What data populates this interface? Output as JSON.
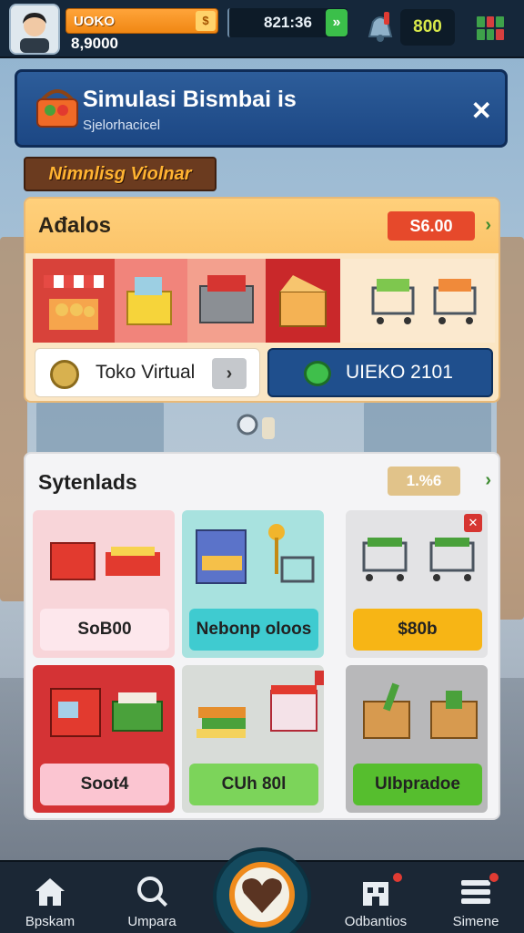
{
  "player": {
    "name": "UOKO",
    "money": "8,9000",
    "timer": "821:36",
    "score": "800"
  },
  "title_panel": {
    "title": "Simulasi Bismbai is",
    "subtitle": "Sjelorhacicel"
  },
  "tag_label": "Nimnlisg Violnar",
  "panel_top": {
    "title": "Ađalos",
    "price": "S6.00",
    "cta_left": "Toko Virtual",
    "cta_right": "UIEKO 2101"
  },
  "panel_bottom": {
    "title": "Sytenlads",
    "percent": "1.%6",
    "cards": [
      {
        "label": "SoB00",
        "bg": "#f8d5d9",
        "btn": "#fde7ec"
      },
      {
        "label": "Nebonp oloos",
        "bg": "#a8e2df",
        "btn": "#3fcbd0"
      },
      {
        "label": "$80b",
        "bg": "#e3e3e5",
        "btn": "#f7b515"
      },
      {
        "label": "Soot4",
        "bg": "#d43335",
        "btn": "#fbc5d1"
      },
      {
        "label": "CUh 80l",
        "bg": "#d8dcd8",
        "btn": "#7cd45a"
      },
      {
        "label": "UIbpradoe",
        "bg": "#b8b8ba",
        "btn": "#56be2e"
      }
    ]
  },
  "nav": {
    "items": [
      {
        "label": "Bpskam",
        "icon": "home-icon"
      },
      {
        "label": "Umpara",
        "icon": "search-icon"
      },
      {
        "label": "Odbantios",
        "icon": "building-icon"
      },
      {
        "label": "Simene",
        "icon": "menu-icon"
      }
    ]
  },
  "colors": {
    "topbar": "#15273a",
    "accent_orange": "#f08713",
    "title_blue": "#1c4784",
    "price_red": "#e6492b"
  }
}
